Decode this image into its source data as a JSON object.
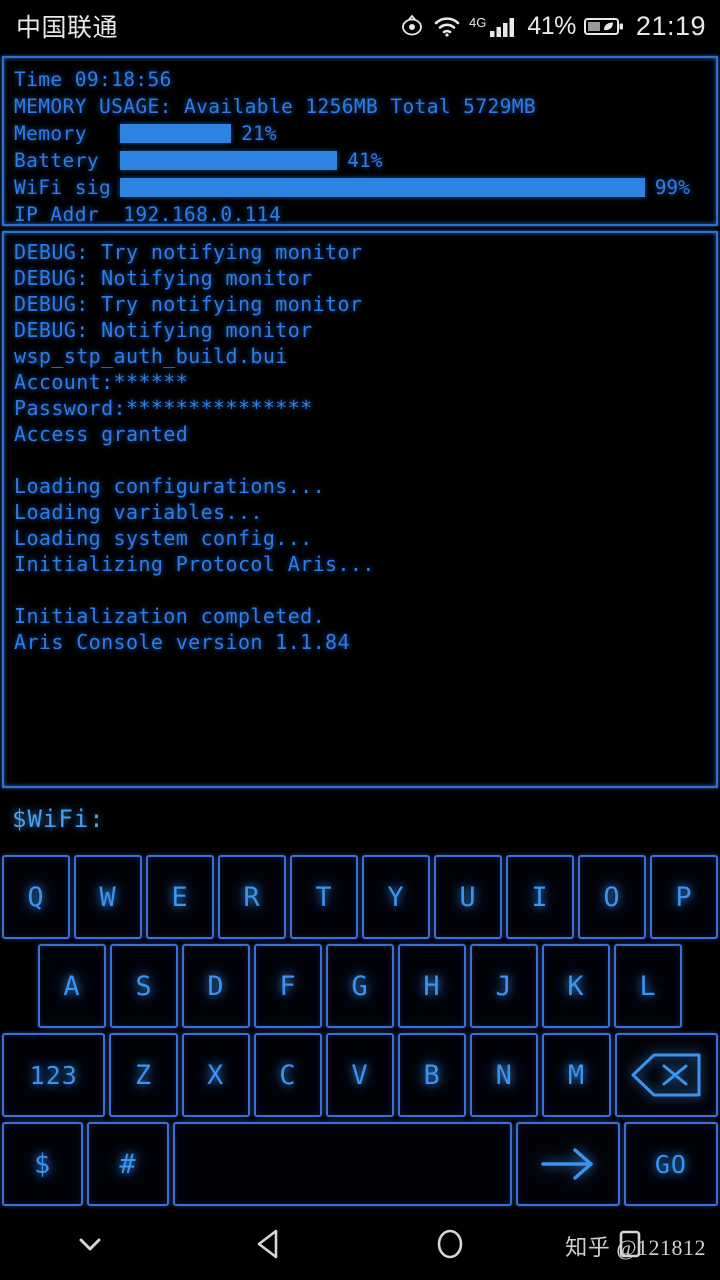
{
  "statusbar": {
    "carrier": "中国联通",
    "eye_icon": "eye-icon",
    "wifi_icon": "wifi-icon",
    "network_type": "4G",
    "signal_icon": "signal-bars-icon",
    "battery_percent": "41%",
    "battery_icon": "battery-saver-icon",
    "time": "21:19"
  },
  "status_panel": {
    "time_line": "Time 09:18:56",
    "memory_line": "MEMORY USAGE: Available 1256MB Total 5729MB",
    "meters": [
      {
        "label": "Memory  ",
        "value": "21%",
        "percent": 21,
        "track_width": 530
      },
      {
        "label": "Battery ",
        "value": "41%",
        "percent": 41,
        "track_width": 530
      },
      {
        "label": "WiFi sig",
        "value": "99%",
        "percent": 99,
        "track_width": 530
      }
    ],
    "ip_line": "IP Addr  192.168.0.114",
    "accent_color": "#2d84e0",
    "border_color": "#2f6fd0"
  },
  "terminal": {
    "lines": [
      "DEBUG: Try notifying monitor",
      "DEBUG: Notifying monitor",
      "DEBUG: Try notifying monitor",
      "DEBUG: Notifying monitor",
      "wsp_stp_auth_build.bui",
      "Account:******",
      "Password:***************",
      "Access granted",
      "",
      "Loading configurations...",
      "Loading variables...",
      "Loading system config...",
      "Initializing Protocol Aris...",
      "",
      "Initialization completed.",
      "Aris Console version 1.1.84"
    ],
    "text_color": "#2e7ce8"
  },
  "prompt": {
    "text": "$WiFi:"
  },
  "keyboard": {
    "row1": [
      {
        "label": "Q",
        "name": "key-q"
      },
      {
        "label": "W",
        "name": "key-w"
      },
      {
        "label": "E",
        "name": "key-e"
      },
      {
        "label": "R",
        "name": "key-r"
      },
      {
        "label": "T",
        "name": "key-t"
      },
      {
        "label": "Y",
        "name": "key-y"
      },
      {
        "label": "U",
        "name": "key-u"
      },
      {
        "label": "I",
        "name": "key-i"
      },
      {
        "label": "O",
        "name": "key-o"
      },
      {
        "label": "P",
        "name": "key-p"
      }
    ],
    "row2": [
      {
        "label": "A",
        "name": "key-a"
      },
      {
        "label": "S",
        "name": "key-s"
      },
      {
        "label": "D",
        "name": "key-d"
      },
      {
        "label": "F",
        "name": "key-f"
      },
      {
        "label": "G",
        "name": "key-g"
      },
      {
        "label": "H",
        "name": "key-h"
      },
      {
        "label": "J",
        "name": "key-j"
      },
      {
        "label": "K",
        "name": "key-k"
      },
      {
        "label": "L",
        "name": "key-l"
      }
    ],
    "row3": [
      {
        "label": "123",
        "name": "key-numeric-mode"
      },
      {
        "label": "Z",
        "name": "key-z"
      },
      {
        "label": "X",
        "name": "key-x"
      },
      {
        "label": "C",
        "name": "key-c"
      },
      {
        "label": "V",
        "name": "key-v"
      },
      {
        "label": "B",
        "name": "key-b"
      },
      {
        "label": "N",
        "name": "key-n"
      },
      {
        "label": "M",
        "name": "key-m"
      },
      {
        "label": "",
        "name": "key-backspace"
      }
    ],
    "row4": [
      {
        "label": "$",
        "name": "key-dollar"
      },
      {
        "label": "#",
        "name": "key-hash"
      },
      {
        "label": "",
        "name": "key-space"
      },
      {
        "label": "",
        "name": "key-arrow-right"
      },
      {
        "label": "GO",
        "name": "key-go"
      }
    ],
    "key_color": "#3a93f0",
    "key_border": "#3b6ed6"
  },
  "navbar": {
    "collapse_icon": "chevron-down-icon",
    "back_icon": "back-triangle-icon",
    "home_icon": "home-circle-icon",
    "recents_icon": "recents-square-icon",
    "watermark": "知乎 @121812"
  }
}
